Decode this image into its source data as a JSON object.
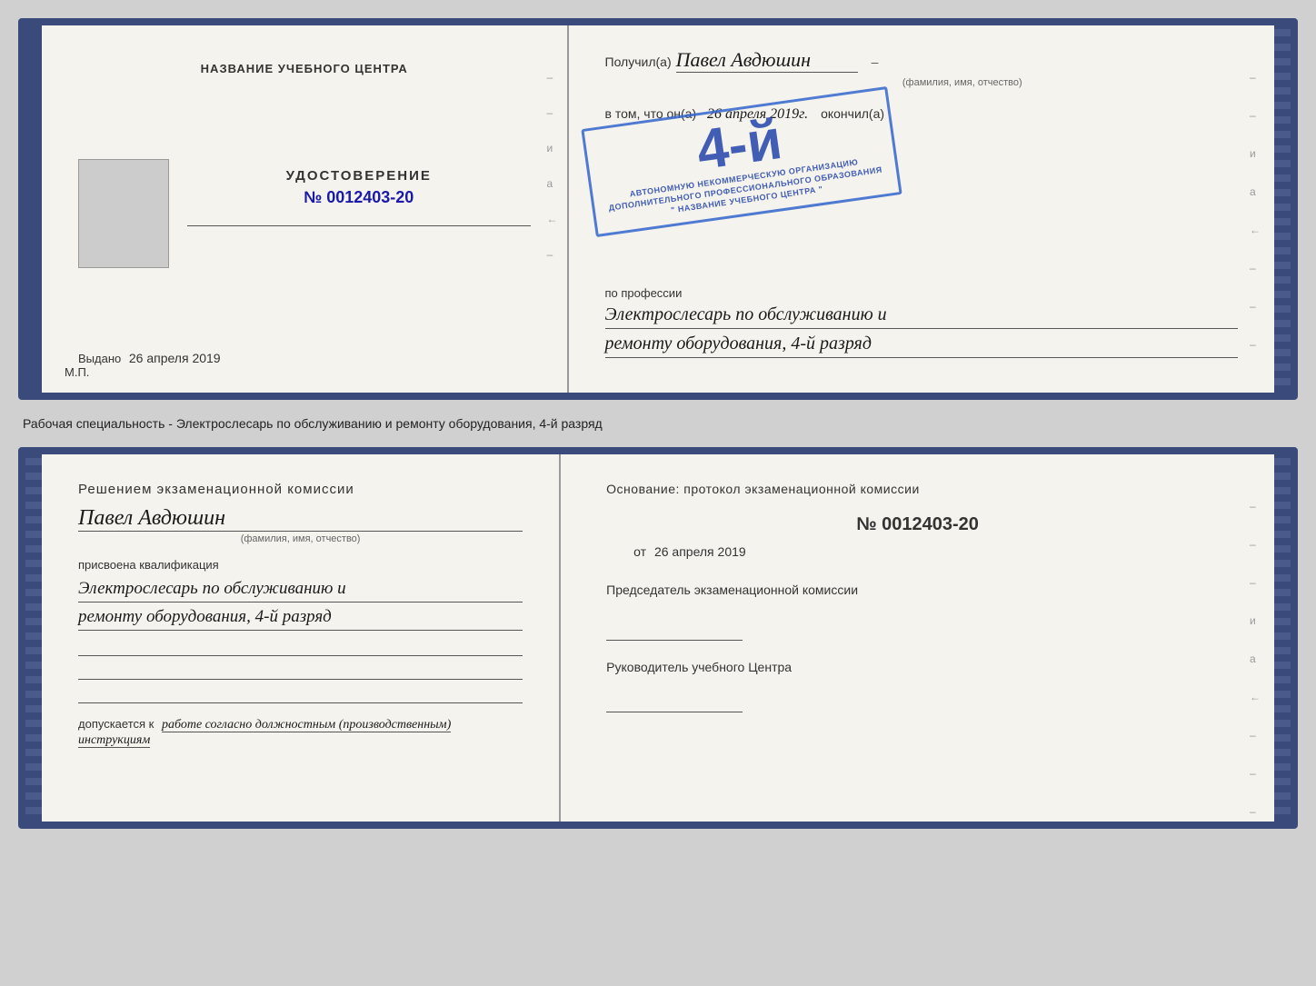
{
  "top_left": {
    "training_center": "НАЗВАНИЕ УЧЕБНОГО ЦЕНТРА",
    "certificate_label": "УДОСТОВЕРЕНИЕ",
    "certificate_number": "№ 0012403-20",
    "issued_label": "Выдано",
    "issued_date": "26 апреля 2019",
    "mp_label": "М.П."
  },
  "top_right": {
    "received_label": "Получил(а)",
    "person_name": "Павел Авдюшин",
    "name_hint": "(фамилия, имя, отчество)",
    "in_that_label": "в том, что он(а)",
    "date": "26 апреля 2019г.",
    "finished_label": "окончил(а)",
    "stamp_grade": "4-й",
    "stamp_line1": "АВ",
    "org_line1": "АВТОНОМНУЮ НЕКОММЕРЧЕСКУЮ ОРГАНИЗАЦИЮ",
    "org_line2": "ДОПОЛНИТЕЛЬНОГО ПРОФЕССИОНАЛЬНОГО ОБРАЗОВАНИЯ",
    "org_line3": "\" НАЗВАНИЕ УЧЕБНОГО ЦЕНТРА \"",
    "profession_label": "по профессии",
    "profession_line1": "Электрослесарь по обслуживанию и",
    "profession_line2": "ремонту оборудования, 4-й разряд"
  },
  "middle_text": "Рабочая специальность - Электрослесарь по обслуживанию и ремонту оборудования, 4-й разряд",
  "bottom_left": {
    "commission_title": "Решением экзаменационной  комиссии",
    "person_name": "Павел Авдюшин",
    "name_hint": "(фамилия, имя, отчество)",
    "assigned_label": "присвоена квалификация",
    "qualification_line1": "Электрослесарь по обслуживанию и",
    "qualification_line2": "ремонту оборудования, 4-й разряд",
    "allowed_label": "допускается к",
    "allowed_text": "работе согласно должностным (производственным) инструкциям"
  },
  "bottom_right": {
    "basis_label": "Основание: протокол экзаменационной  комиссии",
    "protocol_number": "№  0012403-20",
    "date_label": "от",
    "date": "26 апреля 2019",
    "chairman_label": "Председатель экзаменационной комиссии",
    "director_label": "Руководитель учебного Центра"
  },
  "side_dashes": [
    "–",
    "–",
    "и",
    "а",
    "←",
    "–",
    "–",
    "–"
  ]
}
